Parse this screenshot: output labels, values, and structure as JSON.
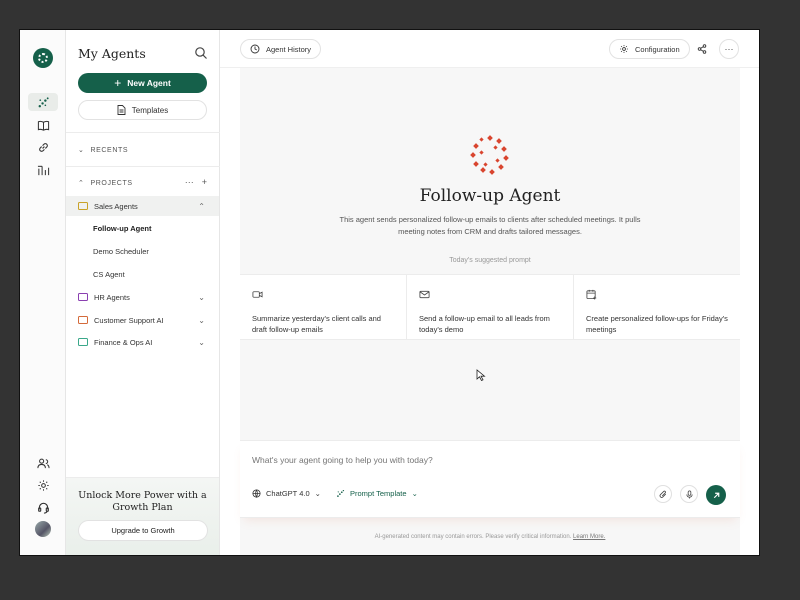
{
  "rail": {
    "icons": [
      "logo-icon",
      "agents-icon",
      "book-icon",
      "link-icon",
      "analytics-icon",
      "users-icon",
      "settings-icon",
      "support-icon",
      "avatar"
    ]
  },
  "sidebar": {
    "title": "My Agents",
    "new_agent": "New Agent",
    "templates": "Templates",
    "recents": "RECENTS",
    "projects": "PROJECTS",
    "projects_tools": [
      "···",
      "+"
    ],
    "project_list": [
      {
        "label": "Sales Agents",
        "color": "#c9a227",
        "expanded": true
      },
      {
        "label": "HR Agents",
        "color": "#8a3fb0",
        "expanded": false
      },
      {
        "label": "Customer Support AI",
        "color": "#d46a3a",
        "expanded": false
      },
      {
        "label": "Finance & Ops AI",
        "color": "#3aa88a",
        "expanded": false
      }
    ],
    "sales_children": [
      "Follow-up Agent",
      "Demo Scheduler",
      "CS Agent"
    ],
    "upsell_text": "Unlock More Power with a Growth Plan",
    "upgrade_button": "Upgrade to Growth"
  },
  "topbar": {
    "history": "Agent History",
    "config": "Configuration",
    "share": "share",
    "more": "···"
  },
  "agent": {
    "title": "Follow-up Agent",
    "description": "This agent sends personalized follow-up emails to clients after scheduled meetings. It pulls meeting notes from CRM and drafts tailored messages.",
    "suggest_label": "Today's suggested prompt",
    "cards": [
      {
        "icon": "video-icon",
        "text": "Summarize yesterday's client calls and draft follow-up emails"
      },
      {
        "icon": "mail-icon",
        "text": "Send a follow-up email to all leads from today's demo"
      },
      {
        "icon": "calendar-add-icon",
        "text": "Create personalized follow-ups for Friday's meetings"
      }
    ]
  },
  "composer": {
    "placeholder": "What's your agent going to help you with today?",
    "model": "ChatGPT 4.0",
    "prompt_template": "Prompt Template"
  },
  "footer": {
    "disclaimer": "AI-generated content may contain errors. Please verify critical information.",
    "learn_more": "Learn More."
  },
  "colors": {
    "accent": "#15604a",
    "brand_logo": "#d9452f"
  }
}
